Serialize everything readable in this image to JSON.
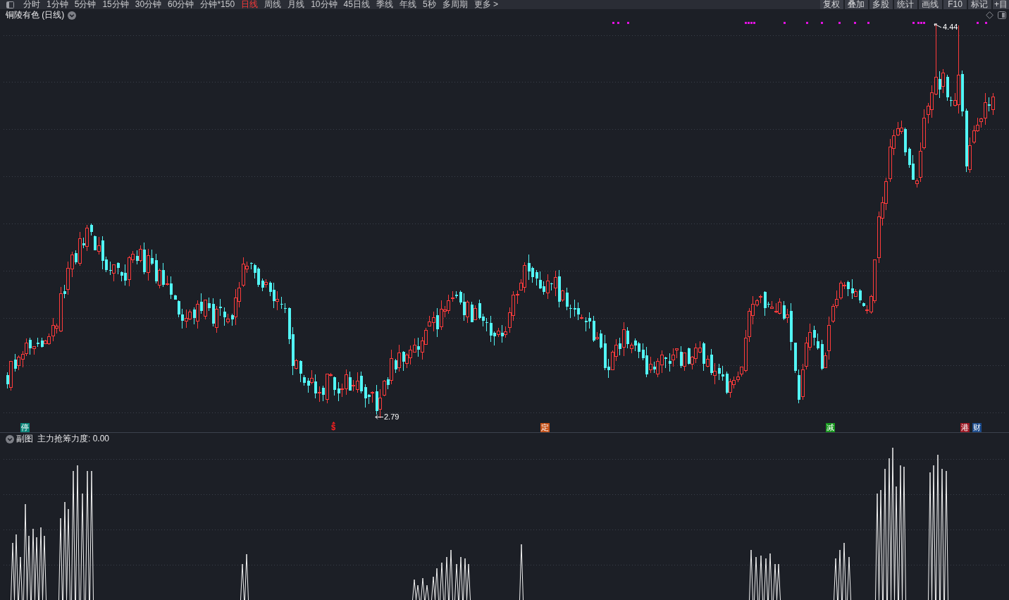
{
  "toolbar": {
    "periods": [
      {
        "label": "分时",
        "selected": false
      },
      {
        "label": "1分钟",
        "selected": false
      },
      {
        "label": "5分钟",
        "selected": false
      },
      {
        "label": "15分钟",
        "selected": false
      },
      {
        "label": "30分钟",
        "selected": false
      },
      {
        "label": "60分钟",
        "selected": false
      },
      {
        "label": "分钟*150",
        "selected": false
      },
      {
        "label": "日线",
        "selected": true
      },
      {
        "label": "周线",
        "selected": false
      },
      {
        "label": "月线",
        "selected": false
      },
      {
        "label": "10分钟",
        "selected": false
      },
      {
        "label": "45日线",
        "selected": false
      },
      {
        "label": "季线",
        "selected": false
      },
      {
        "label": "年线",
        "selected": false
      },
      {
        "label": "5秒",
        "selected": false
      },
      {
        "label": "多周期",
        "selected": false
      },
      {
        "label": "更多 >",
        "selected": false
      }
    ],
    "tools": [
      "复权",
      "叠加",
      "多股",
      "统计",
      "画线",
      "F10",
      "标记",
      "+目"
    ]
  },
  "main_chart": {
    "title": "铜陵有色 (日线)",
    "high_label": "4.44",
    "low_label": "2.79",
    "markers": [
      {
        "label": "停",
        "color": "#0b8479",
        "kind": "tag"
      },
      {
        "label": "$",
        "color": "#ff2020",
        "kind": "symbol"
      },
      {
        "label": "定",
        "color": "#c4521a",
        "kind": "tag"
      },
      {
        "label": "减",
        "color": "#16951c",
        "kind": "tag"
      },
      {
        "label": "港",
        "color": "#9c1824",
        "kind": "tag"
      },
      {
        "label": "财",
        "color": "#1c4c8c",
        "kind": "tag"
      }
    ]
  },
  "sub_chart": {
    "name": "副图",
    "indicator": "主力抢筹力度: 0.00"
  }
}
